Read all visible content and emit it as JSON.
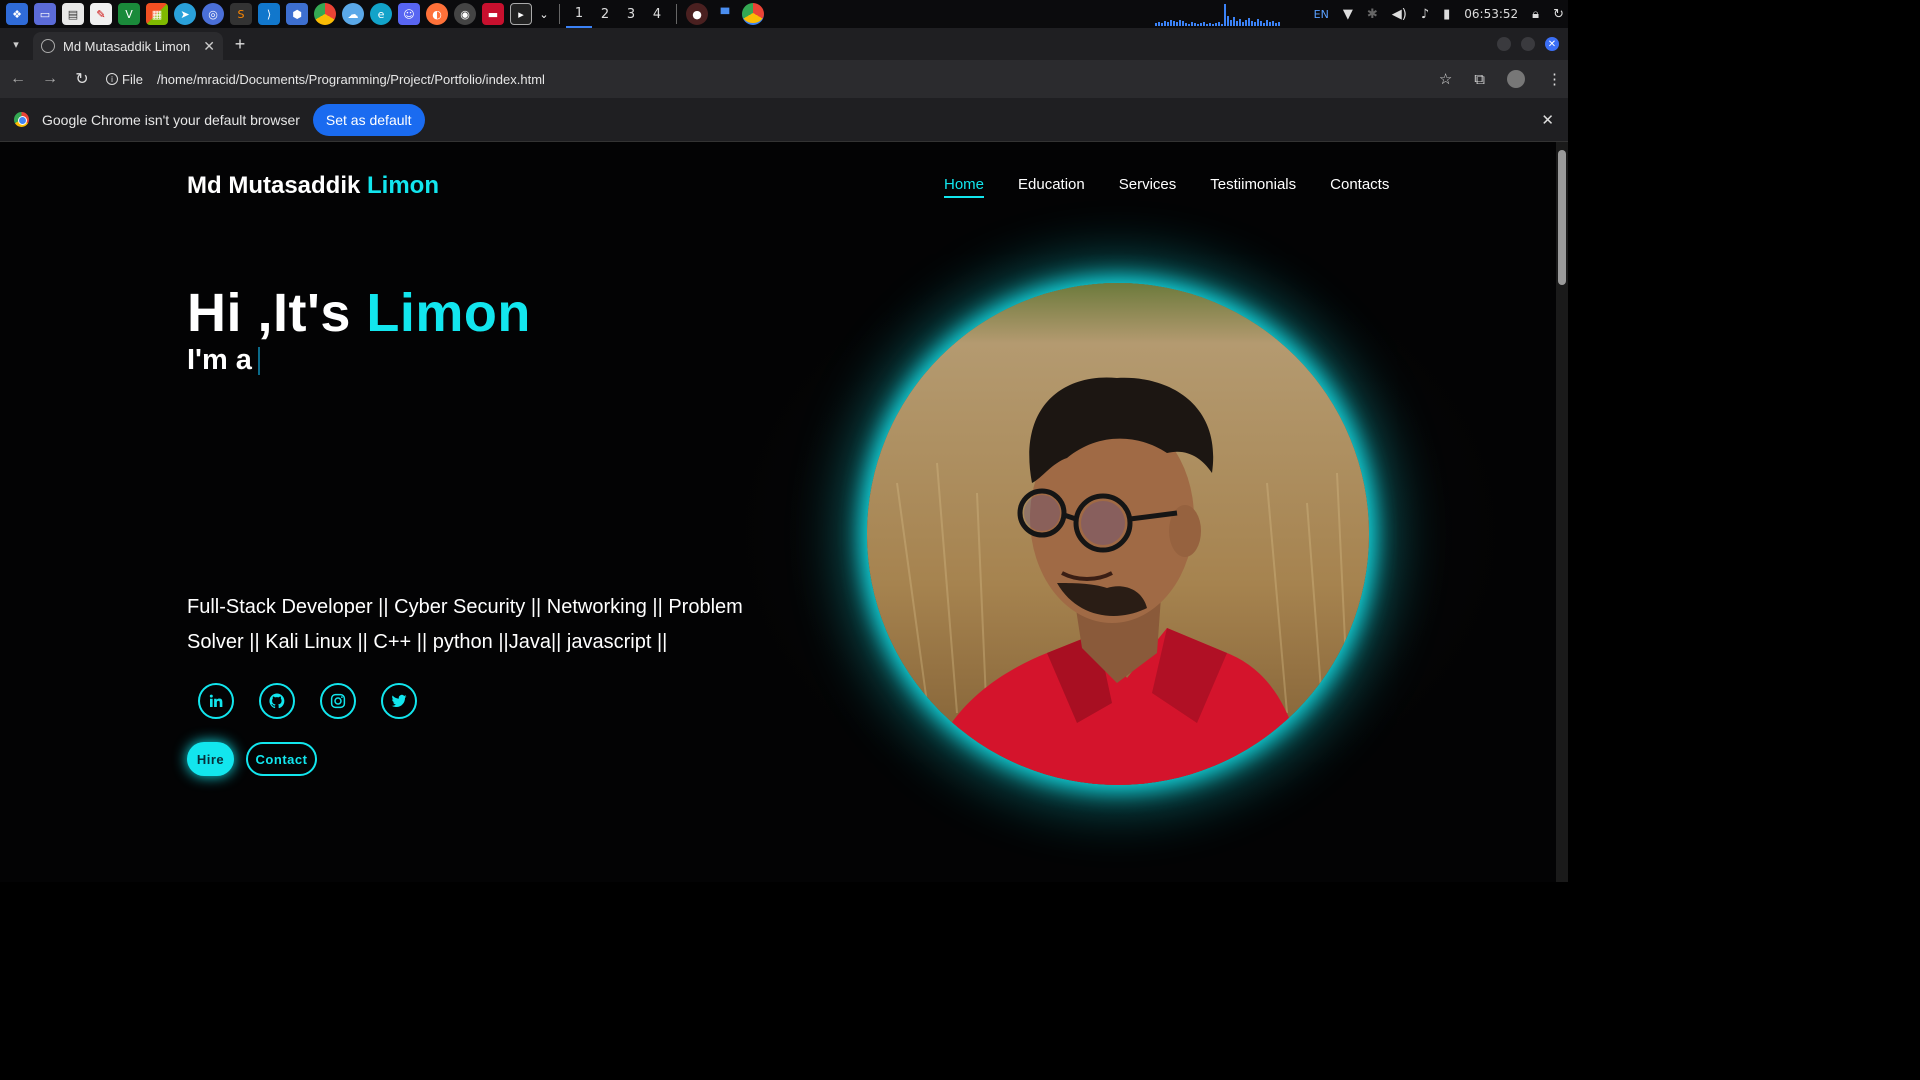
{
  "taskbar": {
    "workspaces": [
      "1",
      "2",
      "3",
      "4"
    ],
    "active_workspace": "1",
    "language": "EN",
    "clock": "06:53:52",
    "app_icons": [
      "system-menu-icon",
      "desktop-icon",
      "file-manager-icon",
      "document-viewer-icon",
      "vim-icon",
      "windows-apps-icon",
      "telegram-icon",
      "browser-icon",
      "sublime-text-icon",
      "vscode-icon",
      "virtualbox-icon",
      "chrome-icon",
      "cloud-icon",
      "edge-icon",
      "discord-icon",
      "firefox-icon",
      "github-icon",
      "terminal-red-icon",
      "terminal-icon"
    ]
  },
  "browser": {
    "tab_title": "Md Mutasaddik Limon",
    "address_scheme_label": "File",
    "address": "/home/mracid/Documents/Programming/Project/Portfolio/index.html",
    "infobar_text": "Google Chrome isn't your default browser",
    "set_default_label": "Set as default"
  },
  "site": {
    "logo_first": "Md Mutasaddik ",
    "logo_accent": "Limon",
    "nav": [
      "Home",
      "Education",
      "Services",
      "Testiimonials",
      "Contacts"
    ],
    "active_nav": "Home",
    "hero_prefix": "Hi ,It's ",
    "hero_accent": "Limon",
    "hero_sub": "I'm a",
    "skills": "Full-Stack Developer || Cyber Security || Networking || Problem Solver || Kali Linux || C++ || python ||Java|| javascript ||",
    "socials": [
      "linkedin-icon",
      "github-icon",
      "instagram-icon",
      "twitter-icon"
    ],
    "hire_label": "Hire",
    "contact_label": "Contact"
  },
  "colors": {
    "accent": "#12e6ee",
    "page_bg": "#030304",
    "browser_blue": "#1a6bf0"
  }
}
